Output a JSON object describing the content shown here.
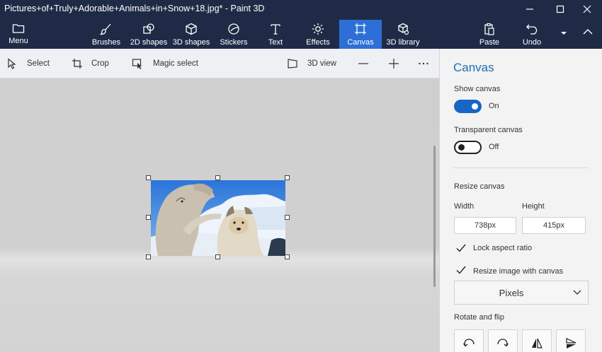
{
  "window": {
    "title": "Pictures+of+Truly+Adorable+Animals+in+Snow+18.jpg* - Paint 3D"
  },
  "ribbon": {
    "menu_label": "Menu",
    "tabs": [
      {
        "label": "Brushes",
        "icon": "brush-icon"
      },
      {
        "label": "2D shapes",
        "icon": "2d-shapes-icon"
      },
      {
        "label": "3D shapes",
        "icon": "3d-shapes-icon"
      },
      {
        "label": "Stickers",
        "icon": "stickers-icon"
      },
      {
        "label": "Text",
        "icon": "text-icon"
      },
      {
        "label": "Effects",
        "icon": "effects-icon"
      },
      {
        "label": "Canvas",
        "icon": "canvas-icon",
        "active": true
      },
      {
        "label": "3D library",
        "icon": "3d-library-icon"
      }
    ],
    "paste_label": "Paste",
    "undo_label": "Undo",
    "active_color": "#2d6fd6",
    "background_color": "#1f2b46"
  },
  "toolbar": {
    "select_label": "Select",
    "crop_label": "Crop",
    "magic_select_label": "Magic select",
    "view_3d_label": "3D view"
  },
  "panel": {
    "title": "Canvas",
    "show_canvas": {
      "label": "Show canvas",
      "state": "On",
      "on": true
    },
    "transparent_canvas": {
      "label": "Transparent canvas",
      "state": "Off",
      "on": false
    },
    "resize_canvas_label": "Resize canvas",
    "width_label": "Width",
    "height_label": "Height",
    "width_value": "738px",
    "height_value": "415px",
    "lock_aspect_label": "Lock aspect ratio",
    "lock_aspect_checked": true,
    "resize_image_label": "Resize image with canvas",
    "resize_image_checked": true,
    "units_value": "Pixels",
    "rotate_flip_label": "Rotate and flip",
    "accent_color": "#1f6fb2"
  }
}
